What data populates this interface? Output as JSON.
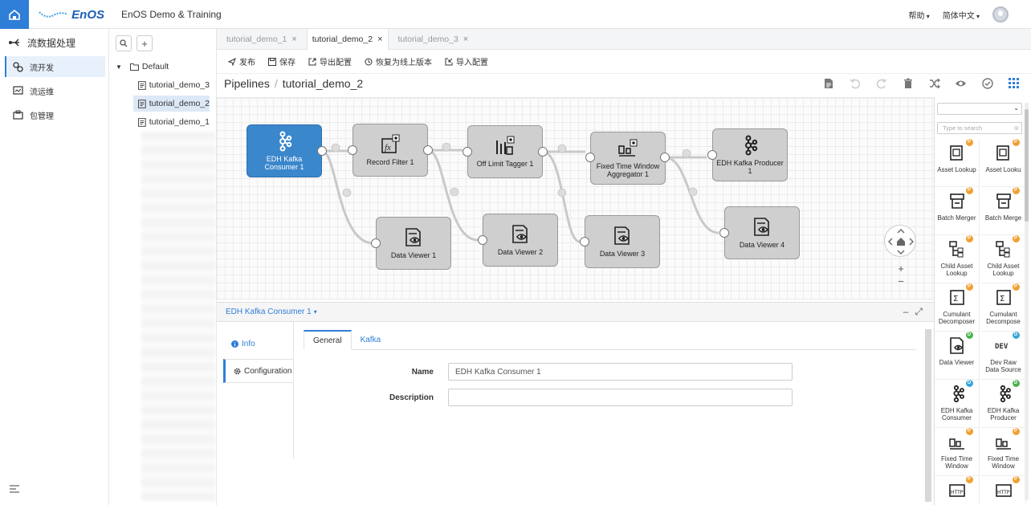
{
  "app": {
    "logo_text": "EnOS",
    "title": "EnOS Demo & Training"
  },
  "topbar": {
    "help": "帮助",
    "language": "简体中文"
  },
  "sidebar": {
    "header": "流数据处理",
    "items": [
      {
        "label": "流开发",
        "active": true
      },
      {
        "label": "流运维"
      },
      {
        "label": "包管理"
      }
    ]
  },
  "tree": {
    "folder": "Default",
    "files": [
      "tutorial_demo_3",
      "tutorial_demo_2",
      "tutorial_demo_1"
    ],
    "selected": "tutorial_demo_2"
  },
  "tabs": [
    {
      "label": "tutorial_demo_1",
      "active": false
    },
    {
      "label": "tutorial_demo_2",
      "active": true
    },
    {
      "label": "tutorial_demo_3",
      "active": false
    }
  ],
  "toolbar": {
    "publish": "发布",
    "save": "保存",
    "export": "导出配置",
    "restore": "恢复为线上版本",
    "import": "导入配置"
  },
  "breadcrumb": {
    "root": "Pipelines",
    "current": "tutorial_demo_2"
  },
  "nodes": [
    {
      "id": "n1",
      "label": "EDH Kafka Consumer 1",
      "line1": "EDH Kafka",
      "line2": "Consumer 1",
      "icon": "kafka-icon"
    },
    {
      "id": "n2",
      "label": "Record Filter 1",
      "line1": "Record Filter 1",
      "line2": "",
      "icon": "function-icon"
    },
    {
      "id": "n3",
      "label": "Off Limit Tagger 1",
      "line1": "Off Limit Tagger 1",
      "line2": "",
      "icon": "tagger-icon"
    },
    {
      "id": "n4",
      "label": "Fixed Time Window Aggregator 1",
      "line1": "Fixed Time Window",
      "line2": "Aggregator 1",
      "icon": "aggregator-icon"
    },
    {
      "id": "n5",
      "label": "EDH Kafka Producer 1",
      "line1": "EDH Kafka Producer",
      "line2": "1",
      "icon": "kafka-icon"
    },
    {
      "id": "n6",
      "label": "Data Viewer 1",
      "line1": "Data Viewer 1",
      "line2": "",
      "icon": "data-viewer-icon"
    },
    {
      "id": "n7",
      "label": "Data Viewer 2",
      "line1": "Data Viewer 2",
      "line2": "",
      "icon": "data-viewer-icon"
    },
    {
      "id": "n8",
      "label": "Data Viewer 3",
      "line1": "Data Viewer 3",
      "line2": "",
      "icon": "data-viewer-icon"
    },
    {
      "id": "n9",
      "label": "Data Viewer 4",
      "line1": "Data Viewer 4",
      "line2": "",
      "icon": "data-viewer-icon"
    }
  ],
  "panel": {
    "title": "EDH Kafka Consumer 1",
    "vtabs": {
      "info": "Info",
      "configuration": "Configuration"
    },
    "htabs": {
      "general": "General",
      "kafka": "Kafka"
    },
    "form": {
      "name_label": "Name",
      "name_value": "EDH Kafka Consumer 1",
      "description_label": "Description",
      "description_value": ""
    }
  },
  "palette": {
    "search_placeholder": "Type to search",
    "items": [
      {
        "l1": "Asset Lookup",
        "l2": "",
        "badge": "P",
        "badge_color": "#f0a030"
      },
      {
        "l1": "Asset Looku",
        "l2": "",
        "badge": "P",
        "badge_color": "#f0a030"
      },
      {
        "l1": "Batch Merger",
        "l2": "",
        "badge": "P",
        "badge_color": "#f0a030"
      },
      {
        "l1": "Batch Merge",
        "l2": "",
        "badge": "P",
        "badge_color": "#f0a030"
      },
      {
        "l1": "Child Asset",
        "l2": "Lookup",
        "badge": "P",
        "badge_color": "#f0a030"
      },
      {
        "l1": "Child Asset",
        "l2": "Lookup",
        "badge": "P",
        "badge_color": "#f0a030"
      },
      {
        "l1": "Cumulant",
        "l2": "Decomposer",
        "badge": "P",
        "badge_color": "#f0a030"
      },
      {
        "l1": "Cumulant",
        "l2": "Decompose",
        "badge": "P",
        "badge_color": "#f0a030"
      },
      {
        "l1": "Data Viewer",
        "l2": "",
        "badge": "D",
        "badge_color": "#4caf50"
      },
      {
        "l1": "Dev Raw",
        "l2": "Data Source",
        "badge": "O",
        "badge_color": "#35a7d8"
      },
      {
        "l1": "EDH Kafka",
        "l2": "Consumer",
        "badge": "O",
        "badge_color": "#35a7d8"
      },
      {
        "l1": "EDH Kafka",
        "l2": "Producer",
        "badge": "D",
        "badge_color": "#4caf50"
      },
      {
        "l1": "Fixed Time",
        "l2": "Window",
        "badge": "P",
        "badge_color": "#f0a030"
      },
      {
        "l1": "Fixed Time",
        "l2": "Window",
        "badge": "P",
        "badge_color": "#f0a030"
      },
      {
        "l1": "",
        "l2": "",
        "badge": "P",
        "badge_color": "#f0a030"
      },
      {
        "l1": "",
        "l2": "",
        "badge": "P",
        "badge_color": "#f0a030"
      }
    ]
  },
  "colors": {
    "accent": "#2f7ed8",
    "node_fill": "#cfcfcf",
    "node_selected": "#3b87cc"
  }
}
